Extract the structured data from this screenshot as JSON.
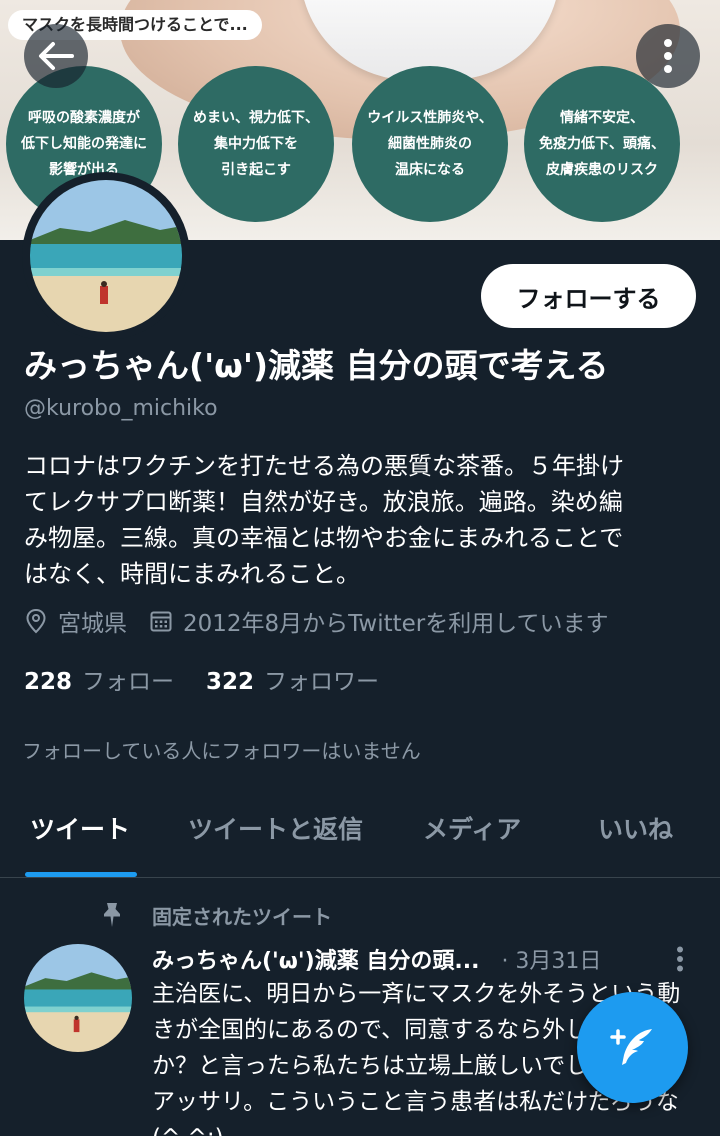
{
  "banner": {
    "caption": "マスクを長時間つけることで...",
    "circles": [
      "呼吸の酸素濃度が\n低下し知能の発達に\n影響が出る",
      "めまい、視力低下、\n集中力低下を\n引き起こす",
      "ウイルス性肺炎や、\n細菌性肺炎の\n温床になる",
      "情緒不安定、\n免疫力低下、頭痛、\n皮膚疾患のリスク"
    ]
  },
  "header": {
    "back_icon": "arrow-left-icon",
    "more_icon": "more-vertical-icon"
  },
  "profile": {
    "follow_label": "フォローする",
    "display_name": "みっちゃん('ω')減薬 自分の頭で考える",
    "handle": "@kurobo_michiko",
    "bio": "コロナはワクチンを打たせる為の悪質な茶番。５年掛け\nてレクサプロ断薬！自然が好き。放浪旅。遍路。染め編\nみ物屋。三線。真の幸福とは物やお金にまみれることで\nはなく、時間にまみれること。",
    "location": "宮城県",
    "joined": "2012年8月からTwitterを利用しています",
    "following_count": "228",
    "following_label": "フォロー",
    "followers_count": "322",
    "followers_label": "フォロワー",
    "mutual_note": "フォローしている人にフォロワーはいません"
  },
  "tabs": [
    {
      "label": "ツイート",
      "active": true
    },
    {
      "label": "ツイートと返信",
      "active": false
    },
    {
      "label": "メディア",
      "active": false
    },
    {
      "label": "いいね",
      "active": false
    }
  ],
  "tweet": {
    "pinned_label": "固定されたツイート",
    "author": "みっちゃん('ω')減薬 自分の頭...",
    "date": "· 3月31日",
    "text": "主治医に、明日から一斉にマスクを外そうという動きが全国的にあるので、同意するなら外しませんか？と言ったら私たちは立場上厳しいでしょうねとアッサリ。こういうこと言う患者は私だけだろうな(^ ^;)"
  },
  "colors": {
    "background": "#15202b",
    "accent": "#1d9bf0",
    "muted": "#8b98a5",
    "divider": "#38444d"
  }
}
